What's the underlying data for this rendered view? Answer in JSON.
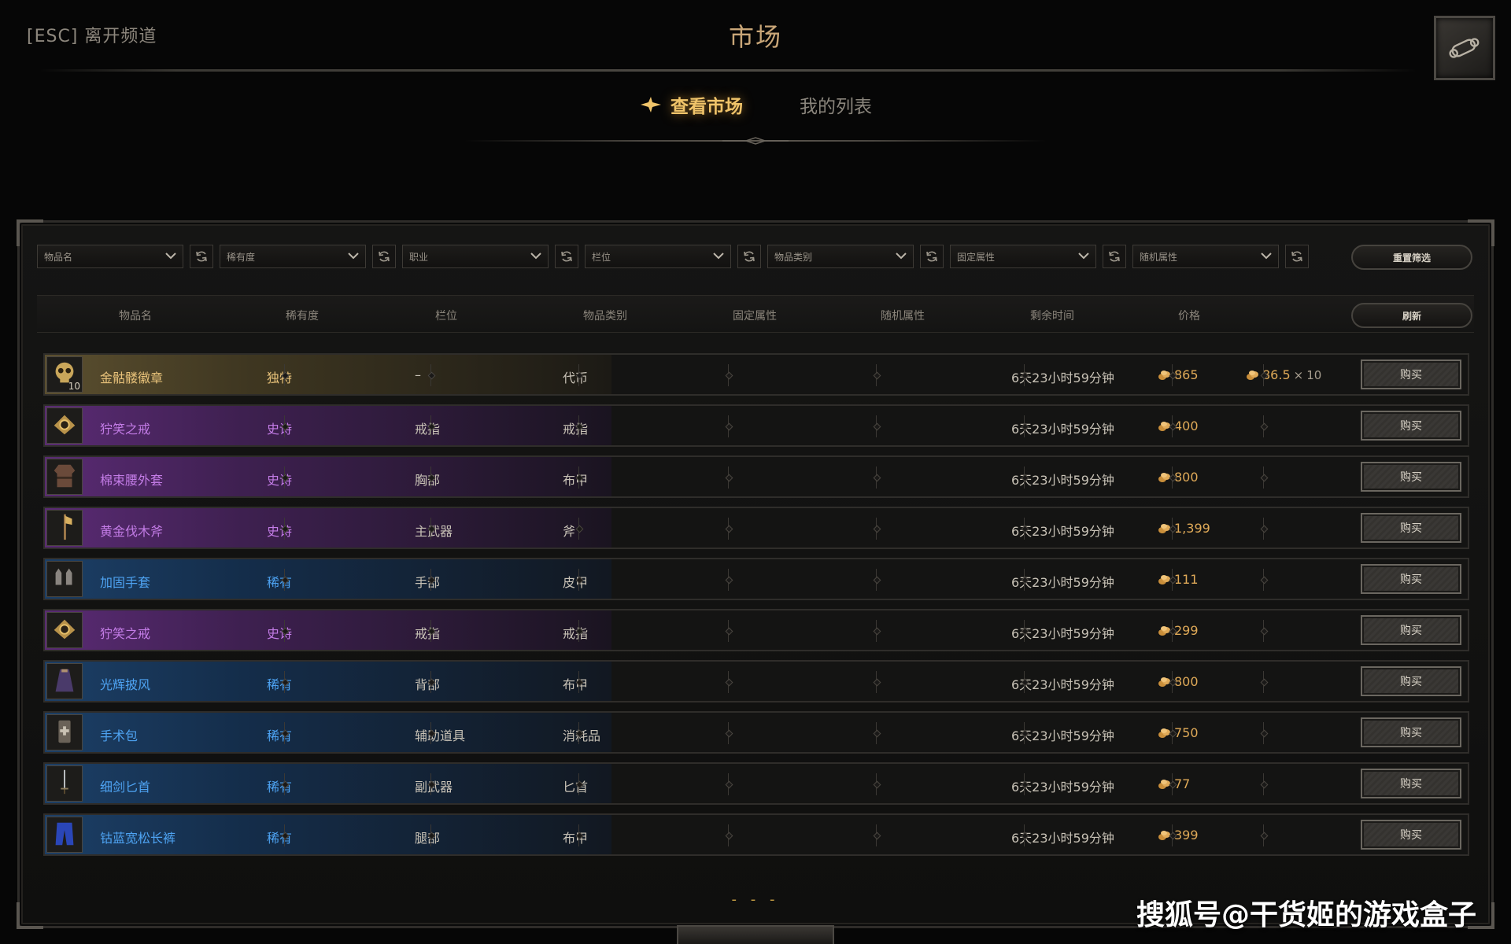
{
  "header": {
    "esc_label": "[ESC] 离开频道",
    "title": "市场",
    "corner_icon": "scroll-icon"
  },
  "tabs": [
    {
      "label": "查看市场",
      "active": true
    },
    {
      "label": "我的列表",
      "active": false
    }
  ],
  "filters": [
    {
      "label": "物品名"
    },
    {
      "label": "稀有度"
    },
    {
      "label": "职业"
    },
    {
      "label": "栏位"
    },
    {
      "label": "物品类别"
    },
    {
      "label": "固定属性"
    },
    {
      "label": "随机属性"
    }
  ],
  "reset_label": "重置筛选",
  "refresh_label": "刷新",
  "columns": [
    "物品名",
    "稀有度",
    "栏位",
    "物品类别",
    "固定属性",
    "随机属性",
    "剩余时间",
    "价格"
  ],
  "buy_label": "购买",
  "colors": {
    "unique": "#e8c27a",
    "epic": "#c37ce6",
    "rare": "#4ea3f2",
    "gold": "#e0aa58",
    "tab_active": "#f0c46a"
  },
  "listings": [
    {
      "name": "金骷髅徽章",
      "rarity": "独特",
      "tier": "unique",
      "slot": "–",
      "type": "代币",
      "time": "6天23小时59分钟",
      "price": "865",
      "unit_price": "86.5",
      "qty": "10",
      "icon": "skull-icon"
    },
    {
      "name": "狞笑之戒",
      "rarity": "史诗",
      "tier": "epic",
      "slot": "戒指",
      "type": "戒指",
      "time": "6天23小时59分钟",
      "price": "400",
      "icon": "ring-icon"
    },
    {
      "name": "棉束腰外套",
      "rarity": "史诗",
      "tier": "epic",
      "slot": "胸部",
      "type": "布甲",
      "time": "6天23小时59分钟",
      "price": "800",
      "icon": "tunic-icon"
    },
    {
      "name": "黄金伐木斧",
      "rarity": "史诗",
      "tier": "epic",
      "slot": "主武器",
      "type": "斧",
      "time": "6天23小时59分钟",
      "price": "1,399",
      "icon": "axe-icon"
    },
    {
      "name": "加固手套",
      "rarity": "稀有",
      "tier": "rare",
      "slot": "手部",
      "type": "皮甲",
      "time": "6天23小时59分钟",
      "price": "111",
      "icon": "gloves-icon"
    },
    {
      "name": "狞笑之戒",
      "rarity": "史诗",
      "tier": "epic",
      "slot": "戒指",
      "type": "戒指",
      "time": "6天23小时59分钟",
      "price": "299",
      "icon": "ring-icon"
    },
    {
      "name": "光辉披风",
      "rarity": "稀有",
      "tier": "rare",
      "slot": "背部",
      "type": "布甲",
      "time": "6天23小时59分钟",
      "price": "800",
      "icon": "cloak-icon"
    },
    {
      "name": "手术包",
      "rarity": "稀有",
      "tier": "rare",
      "slot": "辅助道具",
      "type": "消耗品",
      "time": "6天23小时59分钟",
      "price": "750",
      "icon": "surgical-kit-icon"
    },
    {
      "name": "细剑匕首",
      "rarity": "稀有",
      "tier": "rare",
      "slot": "副武器",
      "type": "匕首",
      "time": "6天23小时59分钟",
      "price": "77",
      "icon": "dagger-icon"
    },
    {
      "name": "钴蓝宽松长裤",
      "rarity": "稀有",
      "tier": "rare",
      "slot": "腿部",
      "type": "布甲",
      "time": "6天23小时59分钟",
      "price": "399",
      "icon": "pants-icon"
    }
  ],
  "pager": "- - -",
  "watermark": "搜狐号@干货姬的游戏盒子"
}
